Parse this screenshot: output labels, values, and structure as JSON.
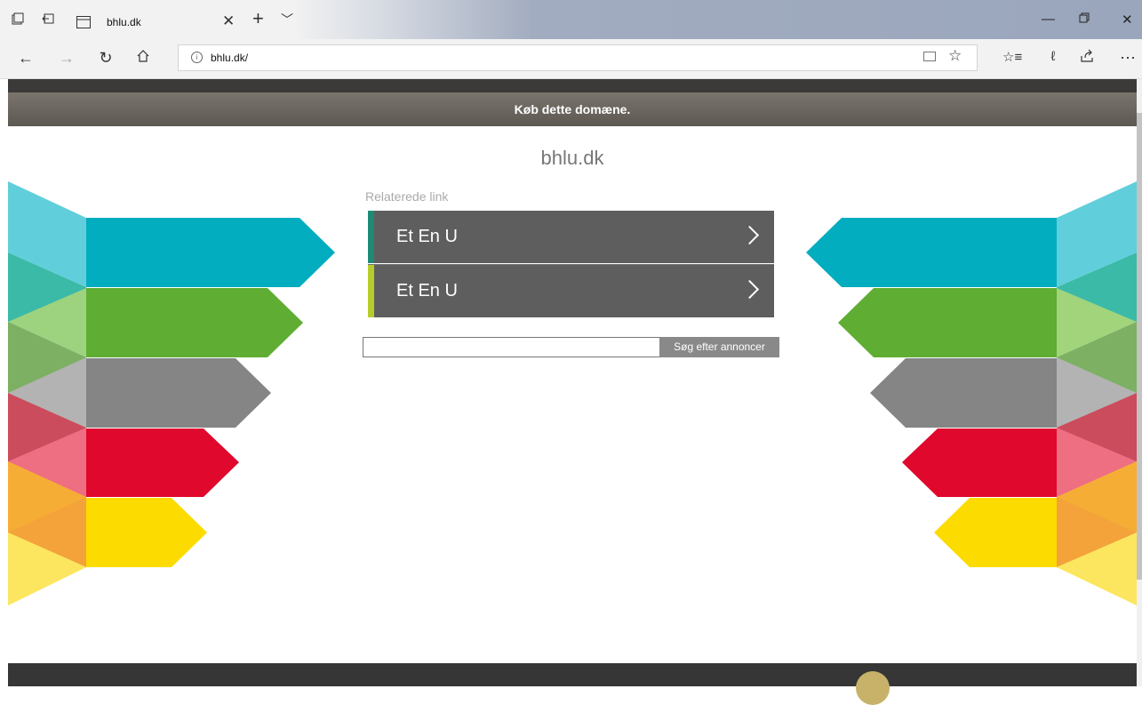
{
  "browser": {
    "tab_title": "bhlu.dk",
    "address": "bhlu.dk/",
    "icons": {
      "tab_actions": "tab-stack-icon",
      "tab_aside": "set-aside-icon",
      "page": "page-icon",
      "close_tab": "close-icon",
      "new_tab": "plus-icon",
      "tab_list": "chevron-down-icon",
      "back": "back-arrow-icon",
      "forward": "forward-arrow-icon",
      "refresh": "refresh-icon",
      "home": "home-icon",
      "info": "info-icon",
      "reading_view": "book-icon",
      "favorite": "star-icon",
      "favorites_hub": "favorites-list-icon",
      "notes": "pen-icon",
      "share": "share-icon",
      "more": "more-icon",
      "minimize": "minimize-icon",
      "restore": "restore-icon",
      "close_window": "close-icon"
    }
  },
  "page": {
    "buy_banner": "Køb dette domæne.",
    "site_title": "bhlu.dk",
    "related_label": "Relaterede link",
    "links": [
      {
        "label": "Et En U",
        "accent": "#1e8a76"
      },
      {
        "label": "Et En U",
        "accent": "#b6cc2a"
      }
    ],
    "search": {
      "value": "",
      "button_label": "Søg efter annoncer"
    }
  },
  "colors": {
    "teal": "#02adbf",
    "green": "#5fad33",
    "gray": "#858585",
    "red": "#e0082c",
    "yellow": "#fcdb00",
    "link_bg": "#5e5e5e"
  }
}
